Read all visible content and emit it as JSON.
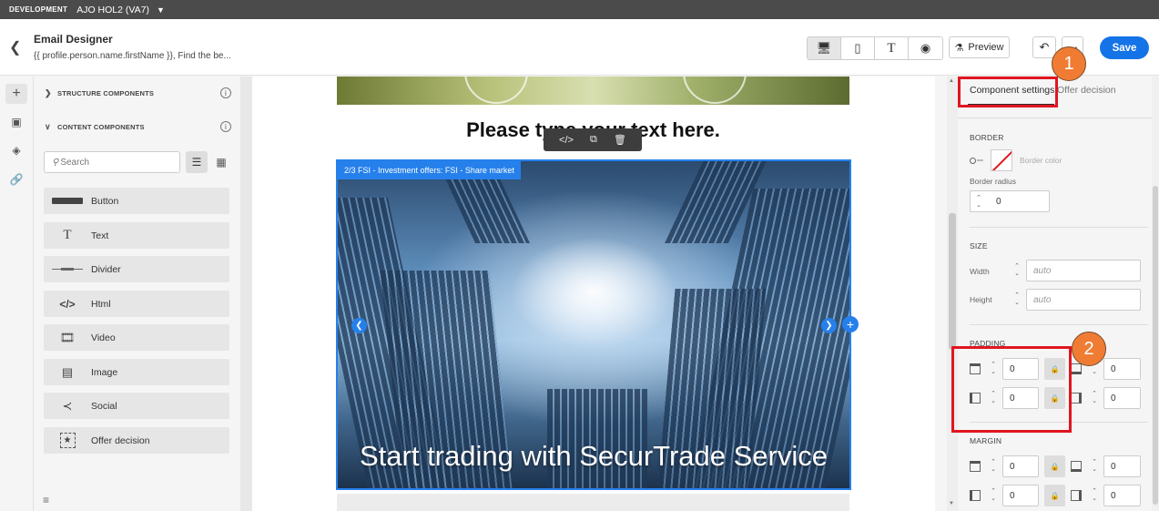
{
  "topbar": {
    "env": "DEVELOPMENT",
    "org": "AJO HOL2 (VA7)"
  },
  "header": {
    "title": "Email Designer",
    "subtitle": "{{ profile.person.name.firstName }}, Find the be...",
    "preview_label": "Preview",
    "save_label": "Save"
  },
  "left_panel": {
    "structure_label": "STRUCTURE COMPONENTS",
    "content_label": "CONTENT COMPONENTS",
    "search_placeholder": "Search",
    "components": [
      {
        "label": "Button",
        "icon": "button-icon"
      },
      {
        "label": "Text",
        "icon": "text-icon"
      },
      {
        "label": "Divider",
        "icon": "divider-icon"
      },
      {
        "label": "Html",
        "icon": "code-icon"
      },
      {
        "label": "Video",
        "icon": "video-icon"
      },
      {
        "label": "Image",
        "icon": "image-icon"
      },
      {
        "label": "Social",
        "icon": "share-icon"
      },
      {
        "label": "Offer decision",
        "icon": "offer-decision-icon"
      }
    ]
  },
  "canvas": {
    "heading": "Please type your text here.",
    "image_label": "2/3 FSI - Investment offers: FSI - Share market",
    "image_caption": "Start trading with SecurTrade Service"
  },
  "right_panel": {
    "tab_component_settings": "Component settings",
    "tab_offer_decision": "Offer decision",
    "border": {
      "title": "BORDER",
      "color_label": "Border color",
      "radius_label": "Border radius",
      "radius_value": "0"
    },
    "size": {
      "title": "SIZE",
      "width_label": "Width",
      "width_placeholder": "auto",
      "height_label": "Height",
      "height_placeholder": "auto"
    },
    "padding": {
      "title": "PADDING",
      "top": "0",
      "right": "0",
      "left": "0",
      "bottom": "0"
    },
    "margin": {
      "title": "MARGIN",
      "top": "0",
      "right": "0",
      "left": "0",
      "bottom": "0"
    }
  },
  "annotations": {
    "badge1": "1",
    "badge2": "2"
  },
  "colors": {
    "accent": "#1473e6",
    "selection": "#2680eb",
    "highlight": "#e0161f",
    "badge": "#f07c33"
  }
}
